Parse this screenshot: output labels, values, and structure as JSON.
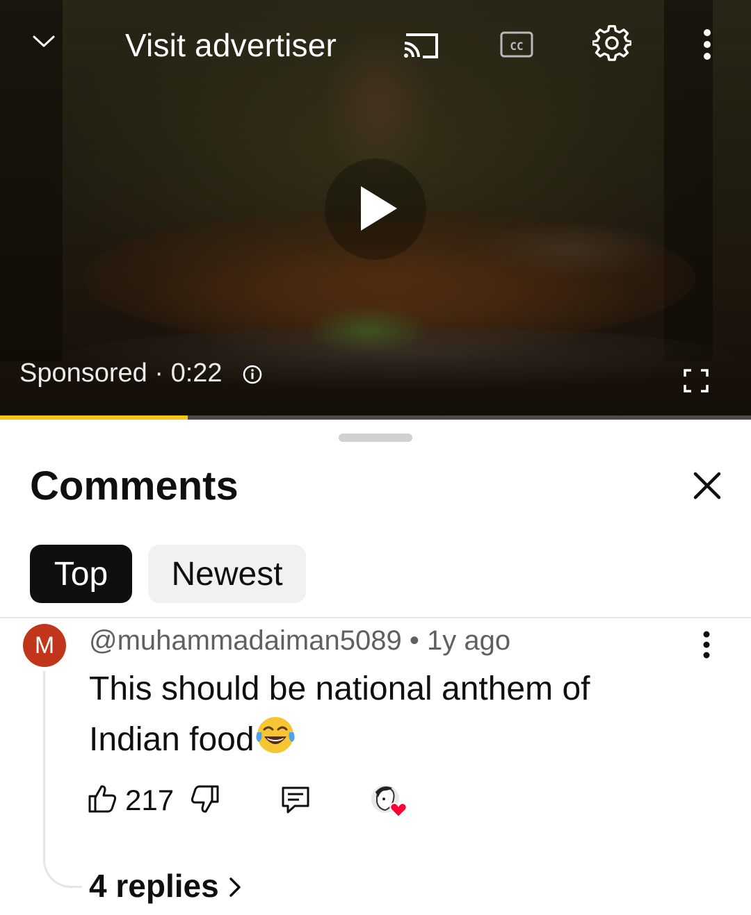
{
  "player": {
    "visit_label": "Visit advertiser",
    "sponsored_label": "Sponsored · 0:22",
    "progress": 0.25,
    "progress_color": "#f5c518",
    "icons": [
      "chevron-down-icon",
      "cast-icon",
      "closed-captions-icon",
      "settings-gear-icon",
      "more-vert-icon",
      "play-icon",
      "info-icon",
      "fullscreen-icon"
    ]
  },
  "comments": {
    "title": "Comments",
    "tabs": [
      {
        "label": "Top",
        "selected": true
      },
      {
        "label": "Newest",
        "selected": false
      }
    ],
    "items": [
      {
        "avatar_letter": "M",
        "avatar_color": "#c1361a",
        "author": "@muhammadaiman5089",
        "age": "1y ago",
        "text_line1": "This should be national anthem of",
        "text_line2": "Indian food",
        "emoji": "face-with-tears-of-joy",
        "likes": "217",
        "replies_label": "4 replies"
      }
    ]
  }
}
